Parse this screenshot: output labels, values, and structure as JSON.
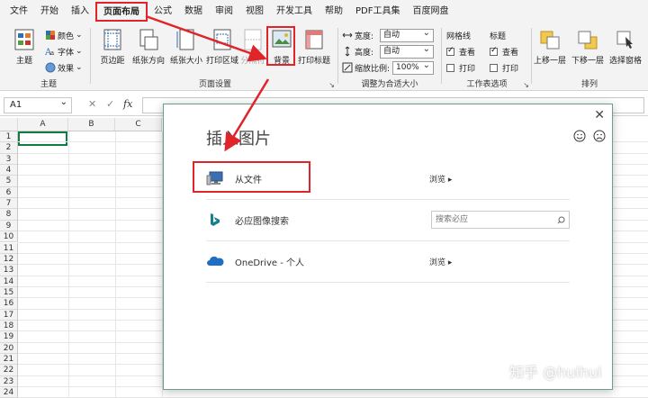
{
  "menu": {
    "items": [
      "文件",
      "开始",
      "插入",
      "页面布局",
      "公式",
      "数据",
      "审阅",
      "视图",
      "开发工具",
      "帮助",
      "PDF工具集",
      "百度网盘"
    ],
    "active_index": 3
  },
  "ribbon": {
    "theme_group": {
      "label": "主题",
      "theme_btn": "主题",
      "colors": "颜色",
      "fonts": "字体",
      "effects": "效果"
    },
    "page_setup_group": {
      "label": "页面设置",
      "margins": "页边距",
      "orientation": "纸张方向",
      "size": "纸张大小",
      "print_area": "打印区域",
      "breaks": "分隔符",
      "background": "背景",
      "print_titles": "打印标题"
    },
    "scale_group": {
      "label": "调整为合适大小",
      "width_label": "宽度:",
      "width_value": "自动",
      "height_label": "高度:",
      "height_value": "自动",
      "scale_label": "缩放比例:",
      "scale_value": "100%"
    },
    "sheet_options_group": {
      "label": "工作表选项",
      "gridlines": "网格线",
      "headings": "标题",
      "view": "查看",
      "print": "打印"
    },
    "arrange_group": {
      "label": "排列",
      "bring_forward": "上移一层",
      "send_backward": "下移一层",
      "selection_pane": "选择窗格"
    }
  },
  "formula_bar": {
    "name_box": "A1",
    "fx": "fx",
    "cancel": "✕",
    "enter": "✓"
  },
  "grid": {
    "columns": [
      "A",
      "B",
      "C"
    ],
    "rows": [
      "1",
      "2",
      "3",
      "4",
      "5",
      "6",
      "7",
      "8",
      "9",
      "10",
      "11",
      "12",
      "13",
      "14",
      "15",
      "16",
      "17",
      "18",
      "19",
      "20",
      "21",
      "22",
      "23",
      "24"
    ]
  },
  "dialog": {
    "title": "插入图片",
    "close": "✕",
    "options": [
      {
        "label": "从文件",
        "action": "浏览 ▸"
      },
      {
        "label": "必应图像搜索",
        "search_placeholder": "搜索必应"
      },
      {
        "label": "OneDrive - 个人",
        "action": "浏览 ▸"
      }
    ]
  },
  "watermark": "知乎 @huihui",
  "colors": {
    "accent_red": "#e0242a",
    "excel_green": "#107c41",
    "onedrive_blue": "#1e6fc4",
    "bing_teal": "#1a7f8c"
  }
}
